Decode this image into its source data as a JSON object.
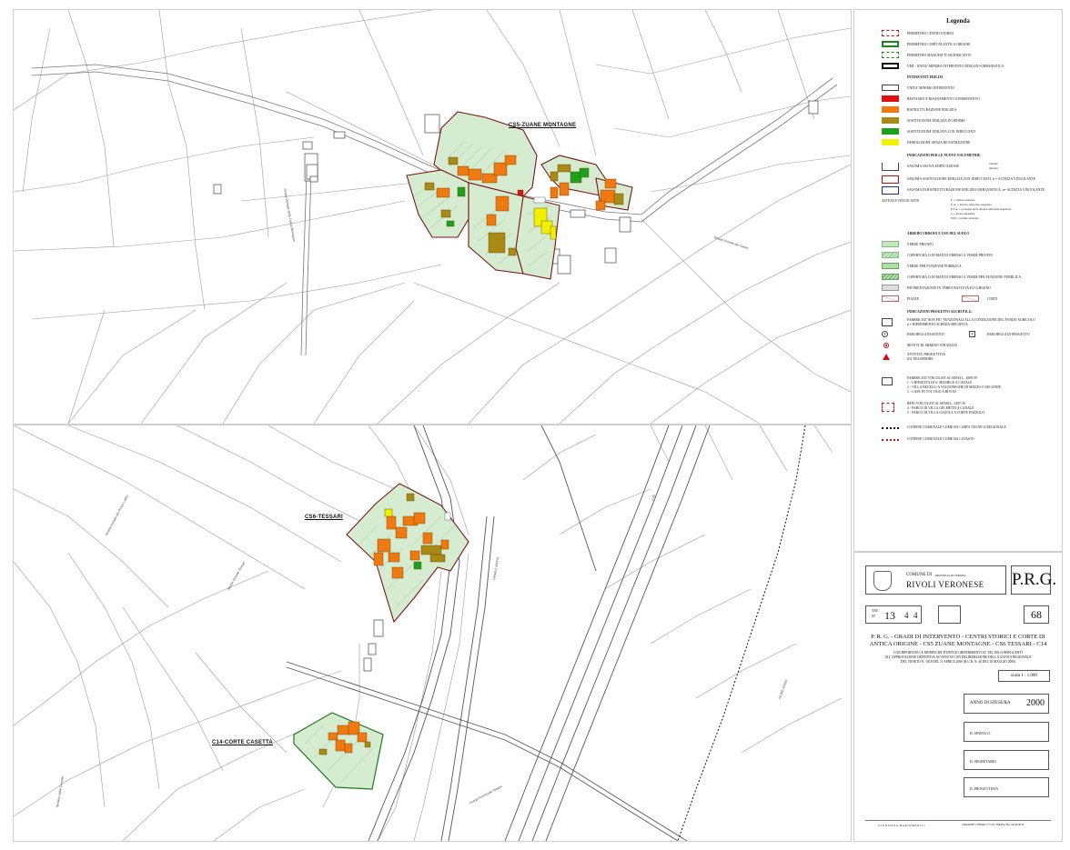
{
  "map_labels": {
    "cs5": "CS5-ZUANE MONTAGNE",
    "cs6": "CS6-TESSARI",
    "c14": "C14-CORTE CASETTA",
    "road_1": "Strada Vicinale della Zuana Montagne",
    "road_2": "Strada Vicinale del Sasso",
    "road_3": "Strada Vicinale dei Pezzo Lettisi",
    "road_4": "Strada Vicinale Tessari",
    "road_5": "CANALE BIFFIS",
    "road_6": "A 22",
    "road_7": "FIUME ADIGE",
    "road_8": "Strada Provinciale Tessari",
    "road_9": "Sentiero delle Cornete"
  },
  "legend": {
    "title": "Legenda",
    "boundaries": [
      "PERIMETRO CENTRI STORICI",
      "PERIMETRO CORTI DI ANTICA ORIGINE",
      "PERIMETRO MANUFATTI SIGNIFICATIVI",
      "UMI - UNITA' MINIMO INTERVENTO EDILIZIO-URBANISTICO"
    ],
    "interventi_heading": "INTERVENTI EDILIZI",
    "interventi": [
      "UNITA' MINIMO INTERVENTO",
      "RESTAURO E RISANAMENTO CONSERVATIVO",
      "RISTRUTTURAZIONE EDILIZIA",
      "SOSTITUZIONE EDILIZIA IN SEDIME",
      "SOSTITUZIONE EDILIZIA CON INDICI DATI",
      "DEMOLIZIONE SENZA RICOSTRUZIONE"
    ],
    "volumetrie_heading": "INDICAZIONI PER LE NUOVE VOLUMETRIE",
    "volumetrie": [
      "SAGOMA NUOVA EDIFICAZIONE",
      "SAGOMA SOSTITUZIONE EDILIZIA CON INDICI DATI, n = ALTEZZA VINCOLANTE",
      "SAGOMA DI RISTRUTTURAZIONE EDILIZIO-URBANISTICA, n= ALTEZZA VINCOLANTE",
      "ALTEZZA VINCOLANTE"
    ],
    "volumetrie_side": [
      "Volume",
      "Altezza"
    ],
    "altezza_codes": [
      "E      = altezza esistente",
      "U.A.   = altezza adiacente segnalata",
      "P.T.A. = prosegue della altezza adiacente segnalata",
      "n      = altezza massima",
      "0.00   = volume esistente"
    ],
    "arredo_heading": "ARREDO URBANO E USO DEL SUOLO",
    "arredo": [
      "VERDE PRIVATO",
      "COPERTURA CON MANTO ERBOSO A VERDE PRIVATO",
      "VERDE PER FUNZIONE PUBBLICA",
      "COPERTURA CON MANTO ERBOSO A VERDE PER FUNZIONE PUBBLICA",
      "PAVIMENTAZIONE IN TERRA BATTUTA E/O GHIAINO"
    ],
    "piazze": "PIAZZE",
    "corti": "CORTI",
    "progetto_heading": "INDICAZIONI PROGETTO ALCHI P.R.G.",
    "progetto": [
      "FABBRICATI NON PIU' FUNZIONALI ALLA CONDUZIONE DEL FONDO AGRICOLO",
      "n = RIFERIMENTO SCHEDA SPECIFICA"
    ],
    "parcheggi_esistenti": "PARCHEGGI ESISTENTI",
    "parcheggi_progetto": "PARCHEGGI DI PROGETTO",
    "arredo_stradale": "MOTIVI DI ARREDO STRADALE",
    "attivita": [
      "ATTIVITA' PRODUTTIVA",
      "DA TRASFERIRE"
    ],
    "vincolati": [
      "FABBRICATI VINCOLATI AI SENSI L. 1089/39",
      "1 - CHIESETTA DI S. MICHELE A CANALE",
      "2 - VILLA BECELLI A VALDONEGHE DI MEZZO O SECONDE",
      "3 - CASE IN VIA VIGO A RIVOLI"
    ],
    "beni": [
      "BENI VINCOLATI AI SENSI L. 1497/39",
      "4 - PARCO DI VILLA GELMETTI A CANALE",
      "5 - PARCO DI VILLA GAZOLA A CORTE POZZOLO"
    ],
    "confine_ctr": "CONFINE COMUNALE COME DA CARTA TECNICA REGIONALE",
    "confine_catasto": "CONFINE COMUNALE COME DA CATASTO"
  },
  "cartouche": {
    "comune_di": "COMUNE DI",
    "provincia": "PROVINCIA DI VERONA",
    "comune": "RIVOLI VERONESE",
    "prg": "P.R.G.",
    "tav_label": "TAV.",
    "n_label": "N°",
    "tav_number": "13",
    "tav_sub1": "4",
    "tav_sub2": "4",
    "page": "68",
    "title_line1": "P. R. G. - GRADI DI INTERVENTO - CENTRI STORICI E CORTE DI",
    "title_line2": "ANTICA ORIGINE - CS5 ZUANE MONTAGNE - CS6 TESSARI - C14",
    "note_line1": "CON RIPORTATE LE MODIFICHE D'UFFICIO (RIFERIMENTI SU TAV. 80) CONSEGUENTI",
    "note_line2": "ALL'APPROVAZIONE DEFINITIVA AVVENUTA CON DELIBERAZIONE DELLA GIUNTA REGIONALE",
    "note_line3": "DEL VENETO N. 1018 DEL 11 APRILE 2000 (B.U.R. N. 46 DEL 16 MAGGIO 2000)",
    "scale": "scala   1 : 1.000",
    "anno_label": "ANNO DI STESURA",
    "anno": "2000",
    "sindaco": "IL SINDACO",
    "segretario": "IL SEGRETARIO",
    "progettista": "IL PROGETTISTA",
    "studio": "S T U D I O   I N G.   M A R I O   M E D I C I",
    "address": "STRADONE S. FERMO 17   37121 VERONA   TEL. 045 8010130"
  },
  "colors": {
    "orange": "#f07a10",
    "red": "#e01010",
    "olive": "#a88a14",
    "green": "#1aa31a",
    "yellow": "#f0f000",
    "verde_privato": "#d6ecd0",
    "perimetro_cs": "#7a1414"
  }
}
